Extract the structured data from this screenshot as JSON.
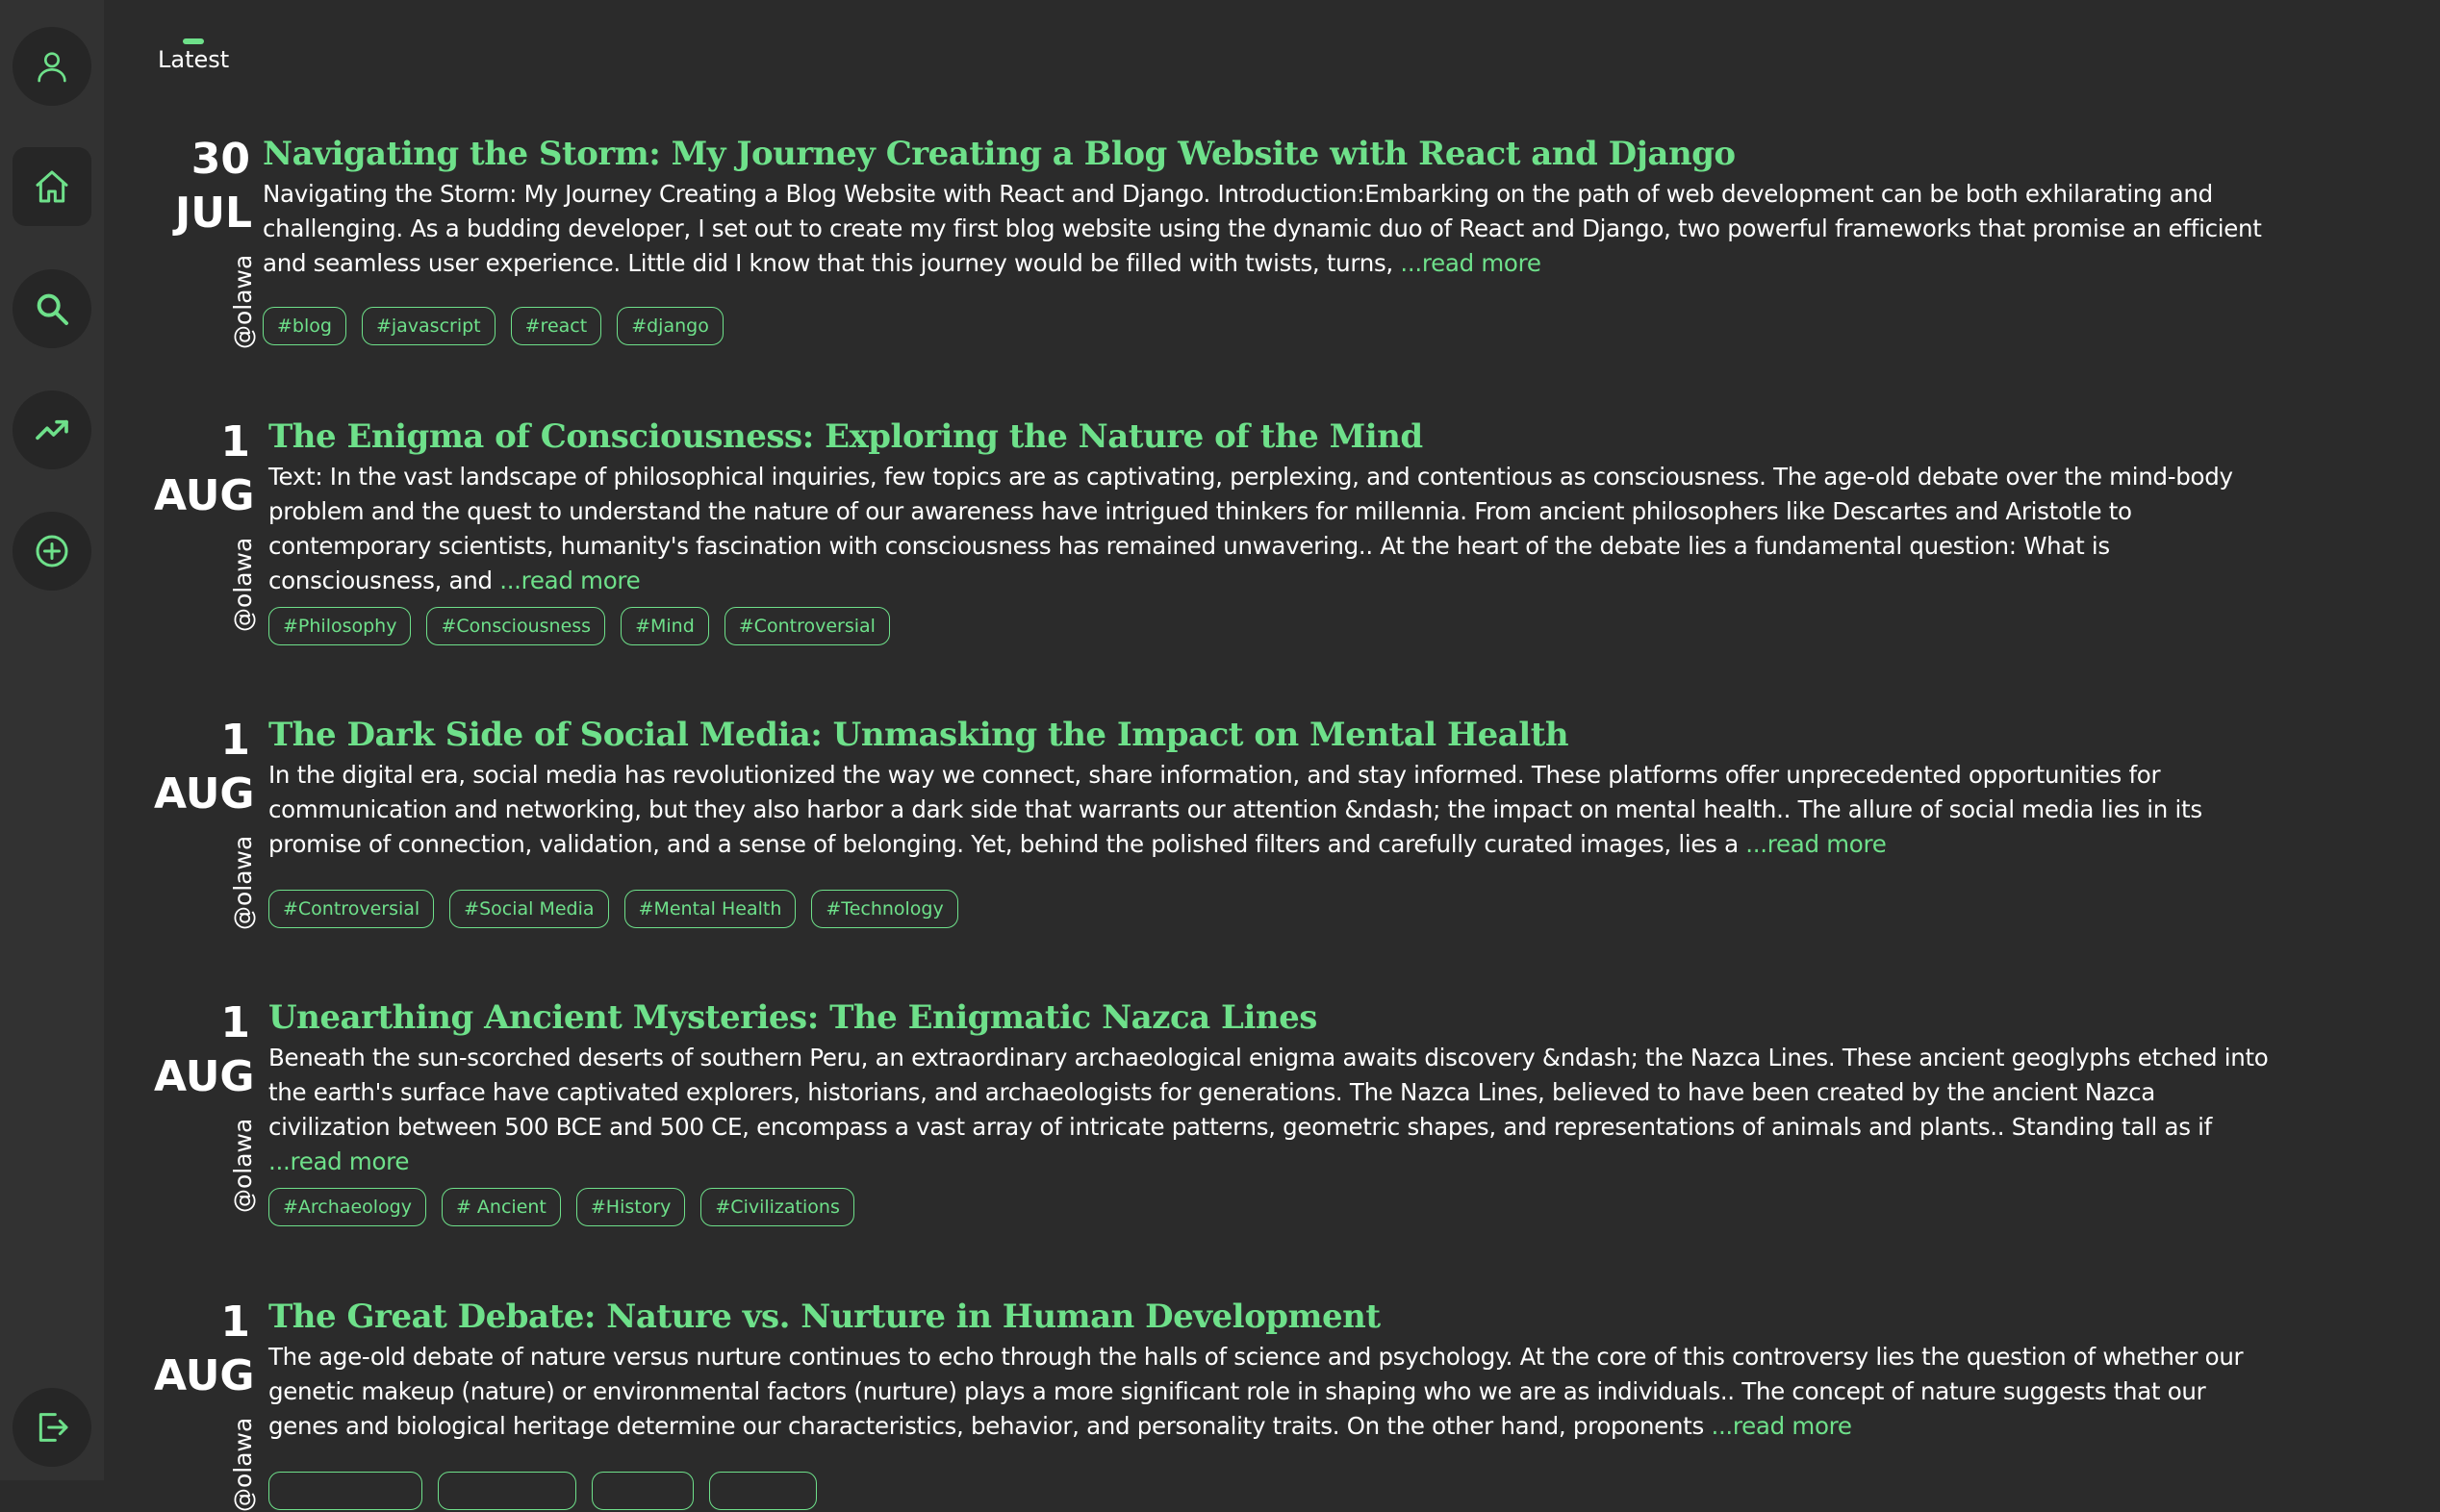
{
  "sidebar": {
    "items": [
      {
        "icon": "user-icon",
        "label": "profile"
      },
      {
        "icon": "home-icon",
        "label": "home"
      },
      {
        "icon": "search-icon",
        "label": "search"
      },
      {
        "icon": "trending-icon",
        "label": "trending"
      },
      {
        "icon": "add-circle-icon",
        "label": "create"
      },
      {
        "icon": "logout-icon",
        "label": "logout"
      }
    ],
    "accent": "#6ee08a"
  },
  "tabs": [
    {
      "label": "Latest"
    }
  ],
  "posts": [
    {
      "day": "30",
      "month": "JUL",
      "author": "@olawa",
      "title": "Navigating the Storm: My Journey Creating a Blog Website with React and Django",
      "excerpt": "Navigating the Storm: My Journey Creating a Blog Website with React and Django. Introduction:Embarking on the path of web development can be both exhilarating and challenging. As a budding developer, I set out to create my first blog website using the dynamic duo of React and Django, two powerful frameworks that promise an efficient and seamless user experience. Little did I know that this journey would be filled with twists, turns, ",
      "read_more": "...read more",
      "tags": [
        "#blog",
        "#javascript",
        "#react",
        "#django"
      ]
    },
    {
      "day": "1",
      "month": "AUG",
      "author": "@olawa",
      "title": "The Enigma of Consciousness: Exploring the Nature of the Mind",
      "excerpt": "Text: In the vast landscape of philosophical inquiries, few topics are as captivating, perplexing, and contentious as consciousness. The age-old debate over the mind-body problem and the quest to understand the nature of our awareness have intrigued thinkers for millennia. From ancient philosophers like Descartes and Aristotle to contemporary scientists, humanity's fascination with consciousness has remained unwavering.. At the heart of the debate lies a fundamental question: What is consciousness, and ",
      "read_more": "...read more",
      "tags": [
        "#Philosophy",
        "#Consciousness",
        "#Mind",
        "#Controversial"
      ]
    },
    {
      "day": "1",
      "month": "AUG",
      "author": "@olawa",
      "title": "The Dark Side of Social Media: Unmasking the Impact on Mental Health",
      "excerpt": "In the digital era, social media has revolutionized the way we connect, share information, and stay informed. These platforms offer unprecedented opportunities for communication and networking, but they also harbor a dark side that warrants our attention &ndash; the impact on mental health.. The allure of social media lies in its promise of connection, validation, and a sense of belonging. Yet, behind the polished filters and carefully curated images, lies a ",
      "read_more": "...read more",
      "tags": [
        "#Controversial",
        "#Social Media",
        "#Mental Health",
        "#Technology"
      ]
    },
    {
      "day": "1",
      "month": "AUG",
      "author": "@olawa",
      "title": "Unearthing Ancient Mysteries: The Enigmatic Nazca Lines",
      "excerpt": "Beneath the sun-scorched deserts of southern Peru, an extraordinary archaeological enigma awaits discovery &ndash; the Nazca Lines. These ancient geoglyphs etched into the earth's surface have captivated explorers, historians, and archaeologists for generations. The Nazca Lines, believed to have been created by the ancient Nazca civilization between 500 BCE and 500 CE, encompass a vast array of intricate patterns, geometric shapes, and representations of animals and plants.. Standing tall as if ",
      "read_more": "...read more",
      "tags": [
        "#Archaeology",
        "# Ancient",
        "#History",
        "#Civilizations"
      ]
    },
    {
      "day": "1",
      "month": "AUG",
      "author": "@olawa",
      "title": "The Great Debate: Nature vs. Nurture in Human Development",
      "excerpt": "The age-old debate of nature versus nurture continues to echo through the halls of science and psychology. At the core of this controversy lies the question of whether our genetic makeup (nature) or environmental factors (nurture) plays a more significant role in shaping who we are as individuals.. The concept of nature suggests that our genes and biological heritage determine our characteristics, behavior, and personality traits. On the other hand, proponents ",
      "read_more": "...read more",
      "tags": [
        "",
        "",
        "",
        ""
      ]
    }
  ]
}
